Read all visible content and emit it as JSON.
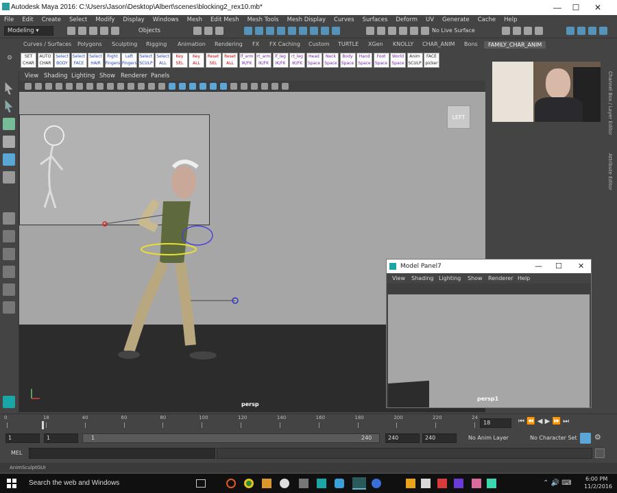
{
  "window": {
    "title": "Autodesk Maya 2016: C:\\Users\\Jason\\Desktop\\Albert\\scenes\\blocking2_rex10.mb*",
    "minimize": "—",
    "maximize": "☐",
    "close": "✕"
  },
  "menubar": [
    "File",
    "Edit",
    "Create",
    "Select",
    "Modify",
    "Display",
    "Windows",
    "Mesh",
    "Edit Mesh",
    "Mesh Tools",
    "Mesh Display",
    "Curves",
    "Surfaces",
    "Deform",
    "UV",
    "Generate",
    "Cache",
    "Help"
  ],
  "statusline": {
    "mode": "Modeling",
    "objects_label": "Objects",
    "live_surface": "No Live Surface"
  },
  "shelf_tabs": [
    "Curves / Surfaces",
    "Polygons",
    "Sculpting",
    "Rigging",
    "Animation",
    "Rendering",
    "FX",
    "FX Caching",
    "Custom",
    "TURTLE",
    "XGen",
    "KNOLLY",
    "CHAR_ANIM",
    "Bons",
    "FAMILY_CHAR_ANIM"
  ],
  "shelf_buttons": [
    {
      "l1": "SET",
      "l2": "CHAR",
      "tone": "black"
    },
    {
      "l1": "AUTO",
      "l2": "CHAR",
      "tone": "black"
    },
    {
      "l1": "Select",
      "l2": "BODY",
      "tone": "blue"
    },
    {
      "l1": "Select",
      "l2": "FACE",
      "tone": "blue"
    },
    {
      "l1": "Select",
      "l2": "HAIR",
      "tone": "blue"
    },
    {
      "l1": "Right",
      "l2": "Fingers",
      "tone": "blue"
    },
    {
      "l1": "Left",
      "l2": "Fingers",
      "tone": "blue"
    },
    {
      "l1": "Select",
      "l2": "SCULP",
      "tone": "blue"
    },
    {
      "l1": "Select",
      "l2": "ALL",
      "tone": "blue"
    },
    {
      "l1": "Key",
      "l2": "SEL",
      "tone": "red"
    },
    {
      "l1": "Key",
      "l2": "ALL",
      "tone": "red"
    },
    {
      "l1": "Reset",
      "l2": "SEL",
      "tone": "red"
    },
    {
      "l1": "Reset",
      "l2": "ALL",
      "tone": "red"
    },
    {
      "l1": "lf_arm",
      "l2": "IK/FK",
      "tone": "purple"
    },
    {
      "l1": "rt_arm",
      "l2": "IK/FK",
      "tone": "purple"
    },
    {
      "l1": "lf_leg",
      "l2": "IK/FK",
      "tone": "purple"
    },
    {
      "l1": "rt_leg",
      "l2": "IK/FK",
      "tone": "purple"
    },
    {
      "l1": "Head",
      "l2": "Space",
      "tone": "purple"
    },
    {
      "l1": "Neck",
      "l2": "Space",
      "tone": "purple"
    },
    {
      "l1": "Body",
      "l2": "Space",
      "tone": "purple"
    },
    {
      "l1": "Hand",
      "l2": "Space",
      "tone": "purple"
    },
    {
      "l1": "Foot",
      "l2": "Space",
      "tone": "purple"
    },
    {
      "l1": "World",
      "l2": "Space",
      "tone": "purple"
    },
    {
      "l1": "Anim",
      "l2": "SCULP",
      "tone": "black"
    },
    {
      "l1": "FACE",
      "l2": "picker",
      "tone": "black"
    }
  ],
  "panel": {
    "menu": [
      "View",
      "Shading",
      "Lighting",
      "Show",
      "Renderer",
      "Panels"
    ],
    "camera_label": "persp",
    "viewcube_label": "LEFT"
  },
  "subwindow": {
    "title": "Model Panel7",
    "menu": [
      "View",
      "Shading",
      "Lighting",
      "Show",
      "Renderer",
      "Help"
    ],
    "camera_label": "persp1"
  },
  "right_strip": {
    "tab1": "Channel Box / Layer Editor",
    "tab2": "Attribute Editor"
  },
  "timeline": {
    "ticks": [
      "0",
      "18",
      "40",
      "60",
      "80",
      "100",
      "120",
      "140",
      "160",
      "180",
      "200",
      "220",
      "24"
    ],
    "current_frame": "18"
  },
  "range": {
    "start": "1",
    "start2": "1",
    "slider_start": "1",
    "slider_end": "240",
    "end": "240",
    "end2": "240",
    "anim_layer": "No Anim Layer",
    "char_set": "No Character Set"
  },
  "mel": {
    "label": "MEL"
  },
  "helpline": "AnimSculptGUI",
  "taskbar": {
    "search": "Search the web and Windows",
    "time": "6:00 PM",
    "date": "11/2/2016"
  },
  "colors": {
    "ui_bg": "#444444",
    "viewport": "#a6a6a6",
    "accent": "#5aa7d6"
  }
}
